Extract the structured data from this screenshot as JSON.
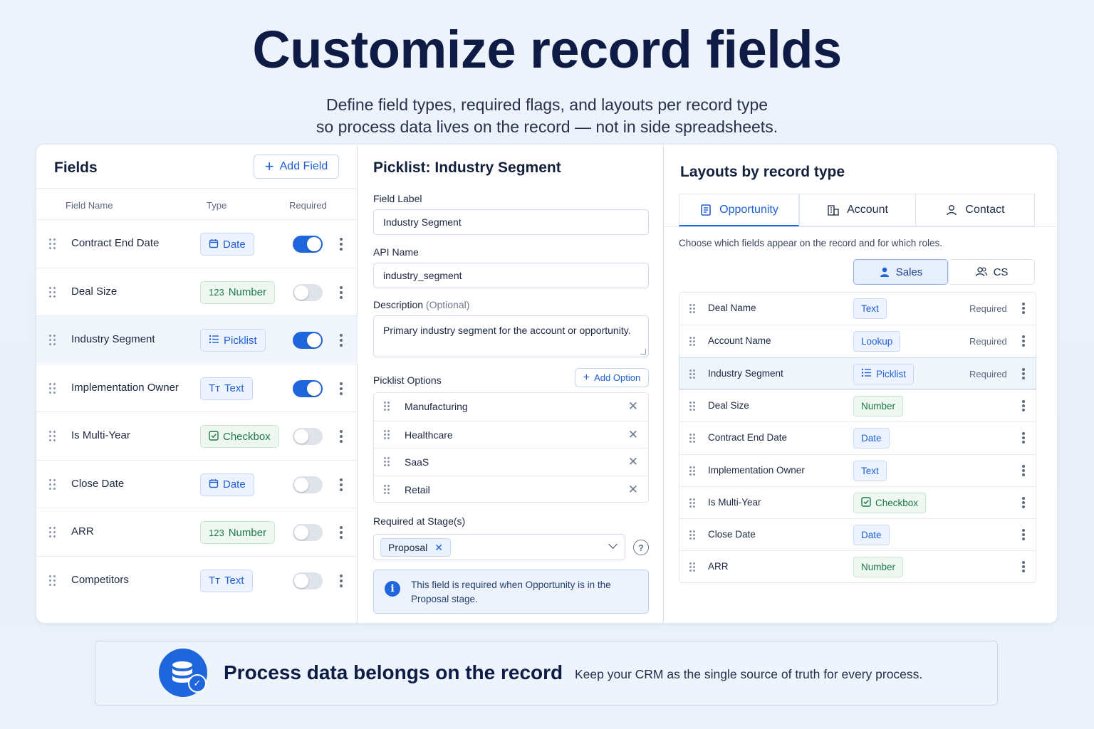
{
  "hero": {
    "title": "Customize record fields",
    "subtitle_line1": "Define field types, required flags, and layouts per record type",
    "subtitle_line2": "so process data lives on the record — not in side spreadsheets."
  },
  "fields_panel": {
    "title": "Fields",
    "add_label": "Add Field",
    "columns": {
      "name": "Field Name",
      "type": "Type",
      "required": "Required"
    },
    "rows": [
      {
        "name": "Contract End Date",
        "type": "Date",
        "type_icon": "calendar-icon",
        "required": true
      },
      {
        "name": "Deal Size",
        "type": "Number",
        "type_icon": "number-icon",
        "required": false
      },
      {
        "name": "Industry Segment",
        "type": "Picklist",
        "type_icon": "list-icon",
        "required": true
      },
      {
        "name": "Implementation Owner",
        "type": "Text",
        "type_icon": "text-icon",
        "required": true
      },
      {
        "name": "Is Multi-Year",
        "type": "Checkbox",
        "type_icon": "checkbox-icon",
        "required": false
      },
      {
        "name": "Close Date",
        "type": "Date",
        "type_icon": "calendar-icon",
        "required": false
      },
      {
        "name": "ARR",
        "type": "Number",
        "type_icon": "number-icon",
        "required": false
      },
      {
        "name": "Competitors",
        "type": "Text",
        "type_icon": "text-icon",
        "required": false
      }
    ],
    "number_glyph": "123",
    "text_glyph": "Tт"
  },
  "picklist_panel": {
    "title": "Picklist: Industry Segment",
    "field_label": {
      "label": "Field Label",
      "value": "Industry Segment"
    },
    "api_name": {
      "label": "API Name",
      "value": "industry_segment"
    },
    "description": {
      "label": "Description",
      "optional": "(Optional)",
      "value": "Primary industry segment for the account or opportunity."
    },
    "options_label": "Picklist Options",
    "add_option_label": "Add Option",
    "options": [
      "Manufacturing",
      "Healthcare",
      "SaaS",
      "Retail"
    ],
    "required_stages_label": "Required at Stage(s)",
    "selected_stage": "Proposal",
    "info_text": "This field is required when Opportunity is in the Proposal stage."
  },
  "layouts_panel": {
    "title": "Layouts by record type",
    "tabs": [
      "Opportunity",
      "Account",
      "Contact"
    ],
    "description": "Choose which fields appear on the record and for which roles.",
    "roles": [
      "Sales",
      "CS"
    ],
    "required_label": "Required",
    "rows": [
      {
        "name": "Deal Name",
        "type": "Text",
        "color": "blue",
        "required": true
      },
      {
        "name": "Account Name",
        "type": "Lookup",
        "color": "blue",
        "required": true
      },
      {
        "name": "Industry Segment",
        "type": "Picklist",
        "color": "blue",
        "required": true
      },
      {
        "name": "Deal Size",
        "type": "Number",
        "color": "green",
        "required": false
      },
      {
        "name": "Contract End Date",
        "type": "Date",
        "color": "blue",
        "required": false
      },
      {
        "name": "Implementation Owner",
        "type": "Text",
        "color": "blue",
        "required": false
      },
      {
        "name": "Is Multi-Year",
        "type": "Checkbox",
        "color": "green",
        "required": false
      },
      {
        "name": "Close Date",
        "type": "Date",
        "color": "blue",
        "required": false
      },
      {
        "name": "ARR",
        "type": "Number",
        "color": "green",
        "required": false
      }
    ]
  },
  "banner": {
    "title": "Process data belongs on the record",
    "text": "Keep your CRM as the single source of truth for every process."
  },
  "colors": {
    "accent": "#1f66dc",
    "heading": "#0d1b45",
    "success": "#1e7a47"
  }
}
